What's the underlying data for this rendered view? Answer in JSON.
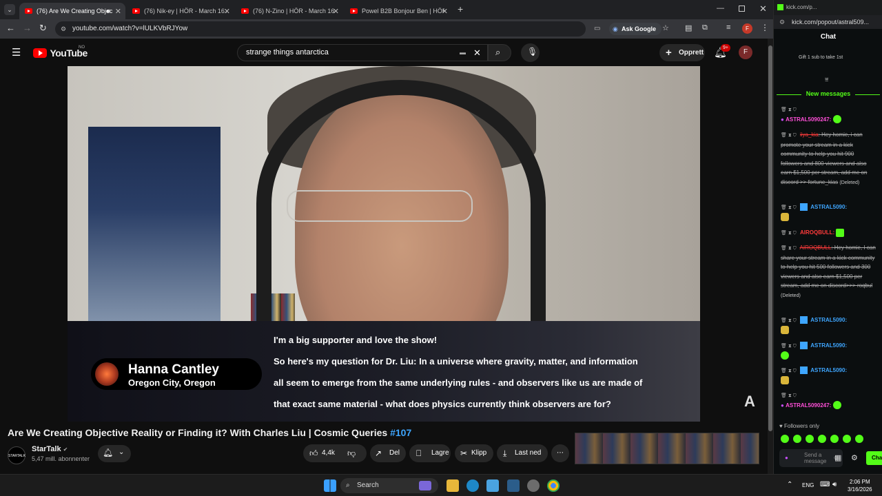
{
  "browser": {
    "tabs": [
      {
        "title": "(76) Are We Creating Objec",
        "active": true
      },
      {
        "title": "(76) Nik-ey | HÖR - March 16 /",
        "active": false
      },
      {
        "title": "(76) N-Zino | HÖR - March 16 /",
        "active": false
      },
      {
        "title": "Powel B2B Bonjour Ben | HÖR",
        "active": false
      }
    ],
    "url": "youtube.com/watch?v=lULKVbRJYow",
    "ask_google": "Ask Google",
    "profile_initial": "F"
  },
  "youtube": {
    "logo_text": "YouTube",
    "region": "NO",
    "search_value": "strange things antarctica",
    "create_label": "Opprett",
    "notif_count": "9+",
    "avatar_initial": "F",
    "video": {
      "guest_name": "Hanna Cantley",
      "guest_location": "Oregon City, Oregon",
      "question_lines": [
        "I'm a big supporter and love the show!",
        "So here's my question for Dr. Liu: In a universe where gravity, matter, and information",
        "all seem to emerge from the same underlying rules - and observers like us are made of",
        "that exact same material - what does physics currently think observers are for?"
      ]
    },
    "title": "Are We Creating Objective Reality or Finding it? With Charles Liu | Cosmic Queries",
    "title_tag": "#107",
    "channel": {
      "name": "StarTalk",
      "subscribers": "5,47 mill. abonnenter",
      "avatar_text": "STARTALK"
    },
    "actions": {
      "likes": "4,4k",
      "share": "Del",
      "save": "Lagre",
      "clip": "Klipp",
      "download": "Last ned",
      "more": "⋯"
    }
  },
  "kick": {
    "window_title": "kick.com/p...",
    "url": "kick.com/popout/astral509...",
    "chat_title": "Chat",
    "gift_text": "Gift 1 sub to take 1st",
    "gift_rank": "1",
    "new_messages_label": "New messages",
    "messages": [
      {
        "user": "ASTRAL5090247:",
        "color": "#ff4fd8",
        "text": "",
        "emote": "green"
      },
      {
        "user": "iiya_kia",
        "color": "#ff3b3b",
        "text": ": Hey homie, i can promote your stream in a kick community to help you hit 900 followers and 800 viewers and also earn $1,500 per stream, add me on discord >> fortune_kias",
        "tag": "(Deleted)"
      },
      {
        "user": "ASTRAL5090:",
        "color": "#3ea6ff",
        "text": "",
        "emote": "gold"
      },
      {
        "user": "AIROQBULL:",
        "color": "#ff3b3b",
        "text": "",
        "emote": "green"
      },
      {
        "user": "AIROQBULL",
        "color": "#ff3b3b",
        "text": ": Hey homie, I can share your stream in a kick community to help you hit 500 followers and 300 viewers and also earn $1,500 per stream, add me on discord>>> roqbul",
        "tag": "(Deleted)"
      },
      {
        "user": "ASTRAL5090:",
        "color": "#3ea6ff",
        "text": "",
        "emote": "gold"
      },
      {
        "user": "ASTRAL5090:",
        "color": "#3ea6ff",
        "text": "",
        "emote": "green"
      },
      {
        "user": "ASTRAL5090:",
        "color": "#3ea6ff",
        "text": "",
        "emote": "gold"
      },
      {
        "user": "ASTRAL5090247:",
        "color": "#ff4fd8",
        "text": "",
        "emote": "green"
      }
    ],
    "followers_only": "Followers only",
    "input_placeholder": "Send a message",
    "send_label": "Chat"
  },
  "taskbar": {
    "search": "Search",
    "language": "ENG",
    "time": "2:06 PM",
    "date": "3/16/2026"
  }
}
